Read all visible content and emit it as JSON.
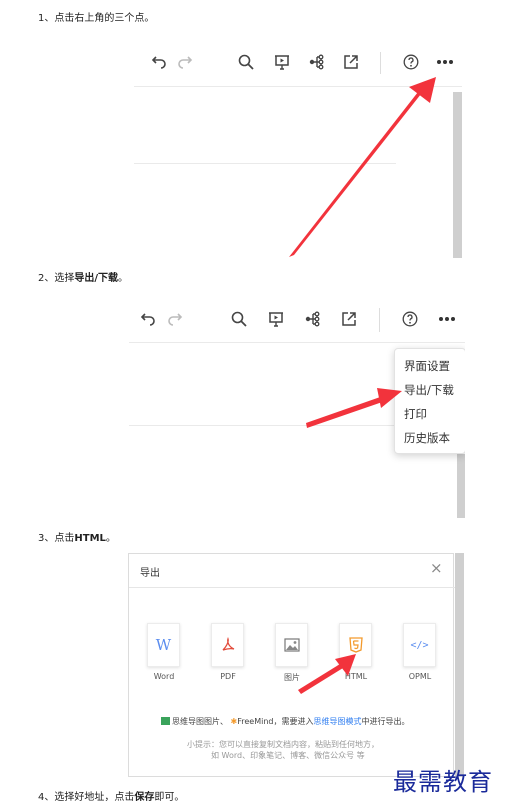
{
  "steps": {
    "s1": "1、点击右上角的三个点。",
    "s2_pre": "2、选择",
    "s2_bold": "导出/下载",
    "s2_post": "。",
    "s3_pre": "3、点击",
    "s3_bold": "HTML",
    "s3_post": "。",
    "s4_pre": "4、选择好地址，点击",
    "s4_bold": "保存",
    "s4_post": "即可。"
  },
  "toolbar": {
    "icons": [
      "undo-icon",
      "redo-icon",
      "search-icon",
      "presentation-icon",
      "mindmap-icon",
      "share-icon",
      "help-icon",
      "more-icon"
    ]
  },
  "menu": {
    "items": [
      "界面设置",
      "导出/下载",
      "打印",
      "历史版本"
    ]
  },
  "export_dialog": {
    "title": "导出",
    "close": "×",
    "formats": [
      "Word",
      "PDF",
      "图片",
      "HTML",
      "OPML"
    ],
    "note1_a": "思维导图图片、",
    "note1_b": "FreeMind，需要进入",
    "note1_link": "思维导图模式",
    "note1_c": "中进行导出。",
    "tip1": "小提示：您可以直接复制文档内容，粘贴到任何地方，",
    "tip2": "如 Word、印象笔记、博客、微信公众号 等"
  },
  "watermark": "最需教育",
  "colors": {
    "arrow": "#f2333c",
    "link": "#2d7cf0",
    "watermark": "#1a2a9a",
    "html_icon": "#f39a2c",
    "pdf_icon": "#e24b3b",
    "word_icon": "#5b8def",
    "opml_icon": "#5b8def"
  }
}
